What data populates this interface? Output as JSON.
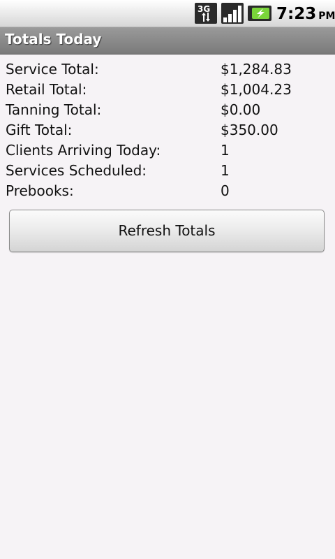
{
  "status_bar": {
    "network_label": "3G",
    "time": "7:23",
    "ampm": "PM",
    "icons": [
      "network-3g-icon",
      "signal-icon",
      "battery-charging-icon"
    ]
  },
  "title_bar": {
    "title": "Totals Today"
  },
  "totals": [
    {
      "label": "Service Total:",
      "value": "$1,284.83"
    },
    {
      "label": "Retail Total:",
      "value": "$1,004.23"
    },
    {
      "label": "Tanning Total:",
      "value": "$0.00"
    },
    {
      "label": "Gift Total:",
      "value": "$350.00"
    },
    {
      "label": "Clients Arriving Today:",
      "value": "1"
    },
    {
      "label": "Services Scheduled:",
      "value": "1"
    },
    {
      "label": "Prebooks:",
      "value": "0"
    }
  ],
  "refresh_button": {
    "label": "Refresh Totals"
  },
  "colors": {
    "background": "#f6f3f6",
    "title_bar": "#8a8a8a",
    "battery_green": "#7ad53a"
  }
}
